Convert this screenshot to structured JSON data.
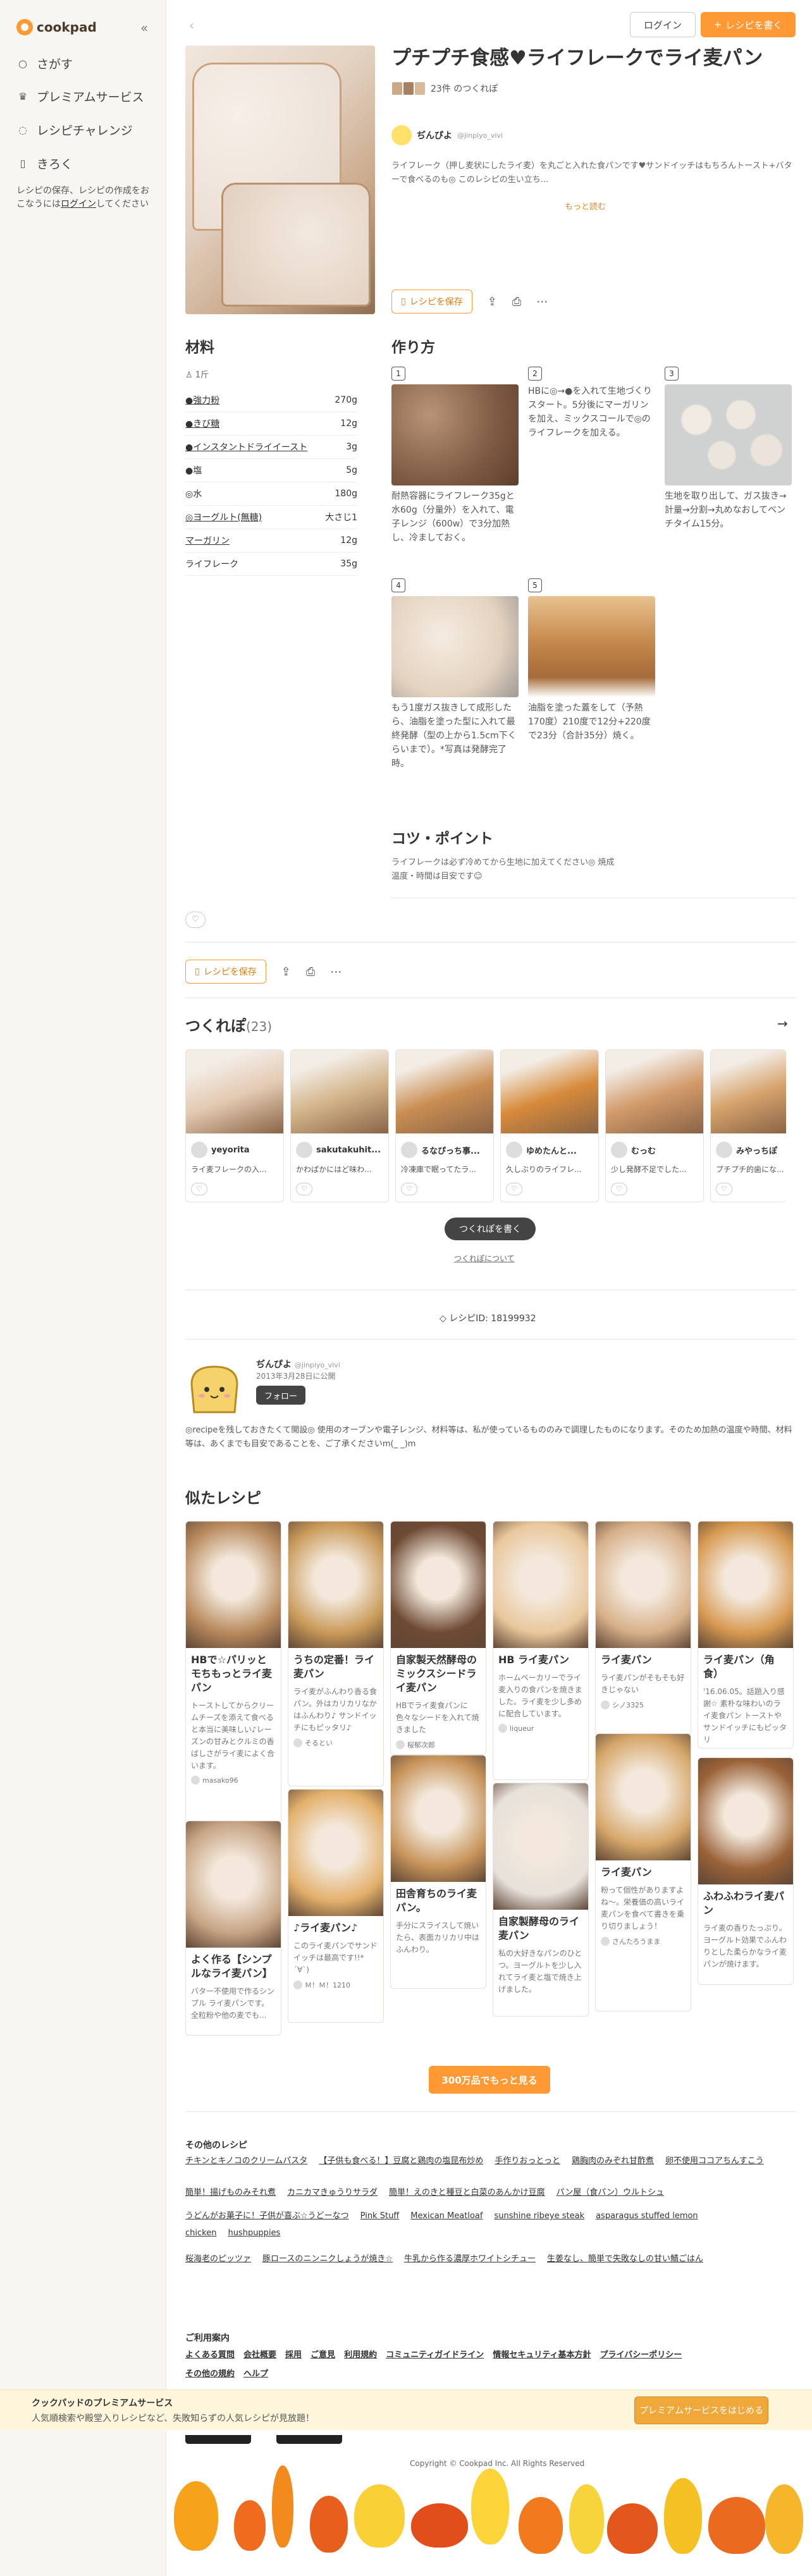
{
  "sidebar": {
    "logo": "cookpad",
    "nav": [
      {
        "label": "さがす",
        "icon": "search-icon"
      },
      {
        "label": "プレミアムサービス",
        "icon": "crown-icon"
      },
      {
        "label": "レシピチャレンジ",
        "icon": "chat-icon"
      },
      {
        "label": "きろく",
        "icon": "bookmark-icon"
      }
    ],
    "note_before": "レシピの保存、レシピの作成をおこなうには",
    "note_link": "ログイン",
    "note_after": "してください"
  },
  "topbar": {
    "login": "ログイン",
    "write": "レシピを書く"
  },
  "recipe": {
    "title": "プチプチ食感♥ライフレークでライ麦パン",
    "tsukurepo_count": "23件 のつくれぽ",
    "author": "ぢんぴよ",
    "author_id": "@jinpiyo_vivi",
    "description": "ライフレーク（押し麦状にしたライ麦）を丸ごと入れた食パンです♥サンドイッチはもちろんトースト+バターで食べるのも◎ このレシピの生い立ち...",
    "more": "もっと読む",
    "save": "レシピを保存"
  },
  "ingredients": {
    "heading": "材料",
    "servings": "1斤",
    "items": [
      {
        "name": "●強力粉",
        "qty": "270g"
      },
      {
        "name": "●きび糖",
        "qty": "12g"
      },
      {
        "name": "●インスタントドライイースト",
        "qty": "3g"
      },
      {
        "name": "●塩",
        "qty": "5g"
      },
      {
        "name": "◎水",
        "qty": "180g"
      },
      {
        "name": "◎ヨーグルト(無糖)",
        "qty": "大さじ1"
      },
      {
        "name": "マーガリン",
        "qty": "12g"
      },
      {
        "name": "ライフレーク",
        "qty": "35g"
      }
    ]
  },
  "steps": {
    "heading": "作り方",
    "items": [
      {
        "num": "1",
        "text": "耐熱容器にライフレーク35gと水60g（分量外）を入れて、電子レンジ（600w）で3分加熱し、冷ましておく。"
      },
      {
        "num": "2",
        "text": "HBに◎→●を入れて生地づくりスタート。5分後にマーガリンを加え、ミックスコールで◎のライフレークを加える。"
      },
      {
        "num": "3",
        "text": "生地を取り出して、ガス抜き→計量→分割→丸めなおしてベンチタイム15分。"
      },
      {
        "num": "4",
        "text": "もう1度ガス抜きして成形したら、油脂を塗った型に入れて最終発酵（型の上から1.5cm下くらいまで）。*写真は発酵完了時。"
      },
      {
        "num": "5",
        "text": "油脂を塗った蓋をして（予熱170度）210度で12分+220度で23分（合計35分）焼く。"
      }
    ]
  },
  "tips": {
    "heading": "コツ・ポイント",
    "text": "ライフレークは必ず冷めてから生地に加えてください◎ 焼成温度・時間は目安です☺"
  },
  "tsukurepo": {
    "heading": "つくれぽ",
    "count": "(23)",
    "cards": [
      {
        "user": "yeyorita",
        "comment": "ライ麦フレークの入..."
      },
      {
        "user": "sakutakuhit...",
        "comment": "かわぱかにはど味わ..."
      },
      {
        "user": "るなぴっち事...",
        "comment": "冷凍庫で眠ってたラ..."
      },
      {
        "user": "ゆめたんと...",
        "comment": "久しぶりのライフレ..."
      },
      {
        "user": "むっむ",
        "comment": "少し発酵不足でした..."
      },
      {
        "user": "みやっちぽ",
        "comment": "プチプチ的歯にな..."
      }
    ],
    "write": "つくれぽを書く",
    "about": "つくれぽについて"
  },
  "recipe_id": "レシピID: 18199932",
  "kitchen": {
    "name": "ぢんぴよ",
    "id": "@jinpiyo_vivi",
    "date": "2013年3月28日に公開",
    "follow": "フォロー",
    "message": "◎recipeを残しておきたくて開設◎ 使用のオーブンや電子レンジ、材料等は、私が使っているもののみで調理したものになります。そのため加熱の温度や時間、材料等は、あくまでも目安であることを、ご了承くださいm(_ _)m"
  },
  "similar": {
    "heading": "似たレシピ",
    "cards": [
      {
        "title": "HBで☆パリッとモちもっとライ麦パン",
        "desc": "トーストしてからクリームチーズを添えて食べると本当に美味しい♪レーズンの甘みとクルミの香ばしさがライ麦によく合います。",
        "author": "masako96"
      },
      {
        "title": "うちの定番！ライ麦パン",
        "desc": "ライ麦がふんわり香る食パン。外はカリカリなかはふんわり♪ サンドイッチにもピッタリ♪",
        "author": "そるとい"
      },
      {
        "title": "自家製天然酵母のミックスシードライ麦パン",
        "desc": "HBでライ麦食パンに色々なシードを入れて焼きました",
        "author": "桜郁次郎"
      },
      {
        "title": "HB ライ麦パン",
        "desc": "ホームベーカリーでライ麦入りの食パンを焼きました。ライ麦を少し多めに配合しています。",
        "author": "liqueur"
      },
      {
        "title": "ライ麦パン",
        "desc": "ライ麦パンがそもそも好きじゃない",
        "author": "シノ3325"
      },
      {
        "title": "ライ麦パン（角食）",
        "desc": "'16.06.05。話題入り感謝☆ 素朴な味わいのライ麦食パン トーストやサンドイッチにもピッタリ",
        "author": "うさぎのシーマ"
      },
      {
        "title": "よく作る【シンプルなライ麦パン】",
        "desc": "バター不使用で作るシンプル ライ麦パンです。全粒粉や他の麦でも...",
        "author": ""
      },
      {
        "title": "♪ライ麦パン♪",
        "desc": "このライ麦パンでサンドイッチは最高です!!*´∀`)",
        "author": "Ｍ！Ｍ！1210"
      },
      {
        "title": "田舎育ちのライ麦パン。",
        "desc": "手分にスライスして焼いたら、表面カリカリ中はふんわり。",
        "author": ""
      },
      {
        "title": "自家製酵母のライ麦パン",
        "desc": "私の大好きなパンのひとつ。ヨーグルトを少し入れてライ麦と塩で焼き上げました。",
        "author": ""
      },
      {
        "title": "ライ麦パン",
        "desc": "粉って個性がありますよね〜。栄養価の高いライ麦パンを食べて書きを乗り切りましょう！",
        "author": "さんたろうまま"
      },
      {
        "title": "ふわふわライ麦パン",
        "desc": "ライ麦の香りたっぷり。ヨーグルト効果でふんわりとした柔らかなライ麦パンが焼けます。",
        "author": ""
      }
    ],
    "more": "300万品でもっと見る"
  },
  "other": {
    "heading": "その他のレシピ",
    "line1": [
      "チキンとキノコのクリームパスタ",
      "【子供も食べる！】豆腐と鶏肉の塩昆布炒め",
      "手作りおっとっと",
      "鶏胸肉のみぞれ甘酢煮",
      "卵不使用ココアちんすこう"
    ],
    "line2": [
      "簡単！揚げものみそれ煮",
      "カニカマきゅうりサラダ",
      "簡単！えのきと種豆と白菜のあんかけ豆腐",
      "パン屋（食パン）ウルトシュ"
    ],
    "line3": [
      "うどんがお菓子に！子供が喜ぶ☆うどーなつ",
      "Pink Stuff",
      "Mexican Meatloaf",
      "sunshine ribeye steak",
      "asparagus stuffed lemon chicken",
      "hushpuppies"
    ],
    "line4": [
      "桜海老のピッツァ",
      "豚ロースのニンニクしょうが焼き☆",
      "牛乳から作る濃厚ホワイトシチュー",
      "生姜なし、簡単で失敗なしの甘い鯖ごはん"
    ]
  },
  "footer": {
    "heading": "ご利用案内",
    "line1": [
      "よくある質問",
      "会社概要",
      "採用",
      "ご意見",
      "利用規約",
      "コミュニティガイドライン",
      "情報セキュリティ基本方針",
      "プライバシーポリシー"
    ],
    "line2": [
      "その他の規約",
      "ヘルプ"
    ],
    "copyright": "Copyright © Cookpad Inc. All Rights Reserved"
  },
  "promo": {
    "title": "クックパッドのプレミアムサービス",
    "text": "人気順検索や殿堂入りレシピなど、失敗知らずの人気レシピが見放題！",
    "button": "プレミアムサービスをはじめる"
  },
  "colors": {
    "brand": "#ff9933",
    "sidebar": "#f8f6f2"
  }
}
